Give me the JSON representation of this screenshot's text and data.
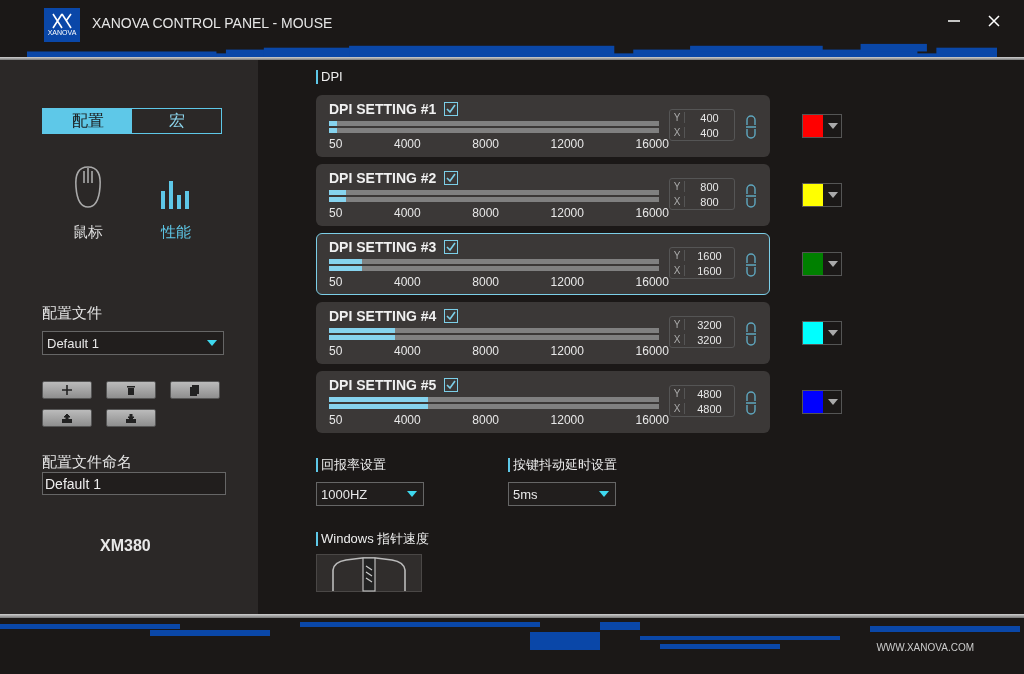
{
  "window": {
    "title": "XANOVA CONTROL PANEL - MOUSE",
    "logo_text": "XANOVA"
  },
  "sidebar": {
    "tabs": [
      {
        "label": "配置",
        "selected": true
      },
      {
        "label": "宏",
        "selected": false
      }
    ],
    "nav": [
      {
        "label": "鼠标",
        "kind": "mouse",
        "selected": false
      },
      {
        "label": "性能",
        "kind": "bars",
        "selected": true
      }
    ],
    "profile_label": "配置文件",
    "profile_value": "Default 1",
    "name_label": "配置文件命名",
    "name_value": "Default 1",
    "model": "XM380"
  },
  "dpi": {
    "heading": "DPI",
    "settings": [
      {
        "title": "DPI SETTING #1",
        "checked": true,
        "selected": false,
        "axes": [
          {
            "label": "Y",
            "value": "400",
            "level": 0.025
          },
          {
            "label": "X",
            "value": "400",
            "level": 0.025
          }
        ],
        "color": "#ff0000",
        "scale": [
          "50",
          "4000",
          "8000",
          "12000",
          "16000"
        ]
      },
      {
        "title": "DPI SETTING #2",
        "checked": true,
        "selected": false,
        "axes": [
          {
            "label": "Y",
            "value": "800",
            "level": 0.05
          },
          {
            "label": "X",
            "value": "800",
            "level": 0.05
          }
        ],
        "color": "#ffff00",
        "scale": [
          "50",
          "4000",
          "8000",
          "12000",
          "16000"
        ]
      },
      {
        "title": "DPI SETTING #3",
        "checked": true,
        "selected": true,
        "axes": [
          {
            "label": "Y",
            "value": "1600",
            "level": 0.1
          },
          {
            "label": "X",
            "value": "1600",
            "level": 0.1
          }
        ],
        "color": "#008000",
        "scale": [
          "50",
          "4000",
          "8000",
          "12000",
          "16000"
        ]
      },
      {
        "title": "DPI SETTING #4",
        "checked": true,
        "selected": false,
        "axes": [
          {
            "label": "Y",
            "value": "3200",
            "level": 0.2
          },
          {
            "label": "X",
            "value": "3200",
            "level": 0.2
          }
        ],
        "color": "#00ffff",
        "scale": [
          "50",
          "4000",
          "8000",
          "12000",
          "16000"
        ]
      },
      {
        "title": "DPI SETTING #5",
        "checked": true,
        "selected": false,
        "axes": [
          {
            "label": "Y",
            "value": "4800",
            "level": 0.3
          },
          {
            "label": "X",
            "value": "4800",
            "level": 0.3
          }
        ],
        "color": "#0000ff",
        "scale": [
          "50",
          "4000",
          "8000",
          "12000",
          "16000"
        ]
      }
    ]
  },
  "polling": {
    "label": "回报率设置",
    "value": "1000HZ"
  },
  "debounce": {
    "label": "按键抖动延时设置",
    "value": "5ms"
  },
  "pointer": {
    "label": "Windows 指针速度"
  },
  "footer": {
    "url": "WWW.XANOVA.COM"
  }
}
